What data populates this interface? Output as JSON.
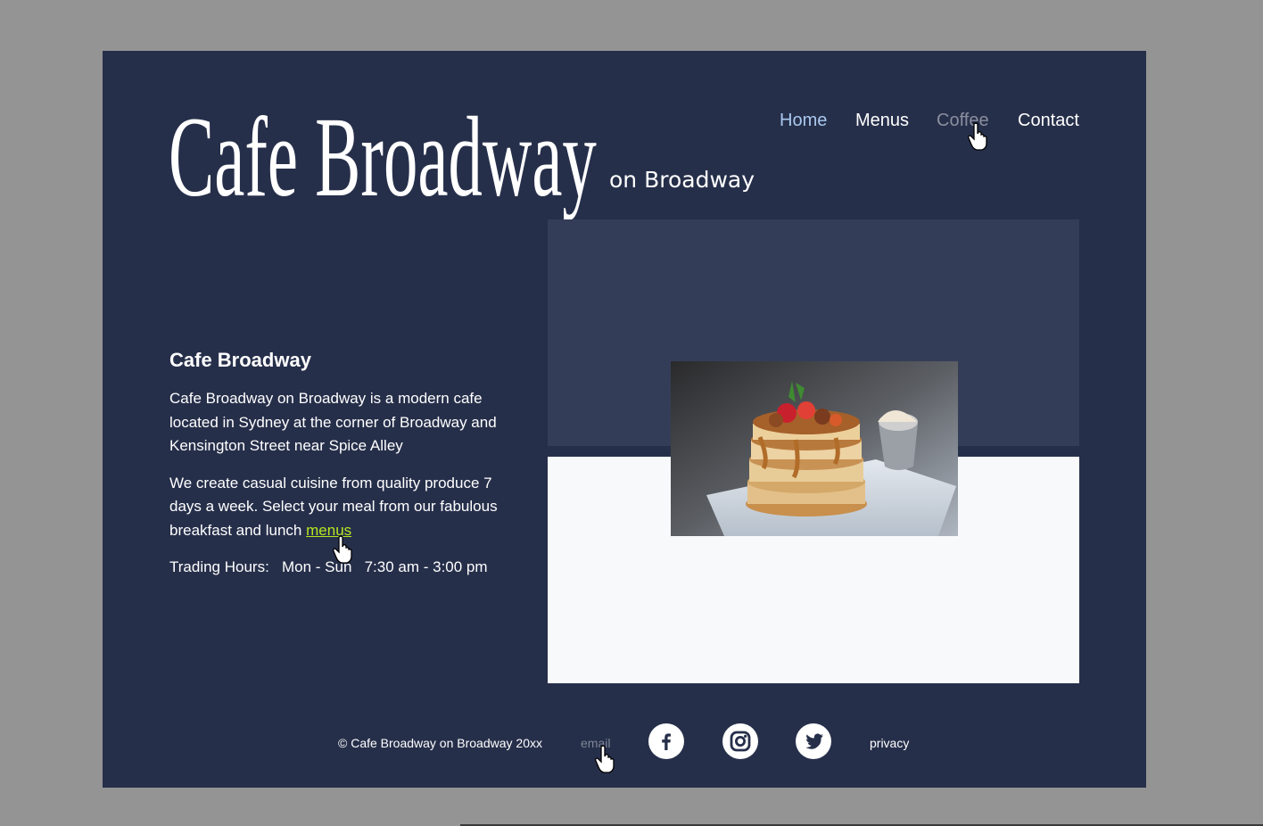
{
  "brand": {
    "name": "Cafe Broadway",
    "tagline": "on Broadway"
  },
  "nav": {
    "items": [
      "Home",
      "Menus",
      "Coffee",
      "Contact"
    ],
    "colors": {
      "home": "#a9c8ee",
      "menus": "#ffffff",
      "coffee": "#8a8f9e",
      "contact": "#ffffff"
    }
  },
  "intro": {
    "title": "Cafe Broadway",
    "para1": "Cafe Broadway on Broadway is a modern cafe located in Sydney at the corner of Broadway and Kensington Street near Spice Alley",
    "para2_text": "We create casual cuisine from quality produce 7 days a week. Select your meal from our fabulous breakfast and lunch",
    "para2_link": "menus",
    "hours_label": "Trading Hours:",
    "hours_days": "Mon - Sun",
    "hours_time": "7:30 am - 3:00 pm"
  },
  "hero": {
    "image": "pancake-stack-photo"
  },
  "footer": {
    "copyright": "© Cafe Broadway on Broadway 20xx",
    "email_label": "email",
    "social": [
      "facebook-icon",
      "instagram-icon",
      "twitter-icon"
    ],
    "privacy_label": "privacy"
  },
  "colors": {
    "page_bg": "#262f4a",
    "hero_top": "#343d58",
    "hero_bottom": "#f8f9fa",
    "link": "#b4e820",
    "outer": "#949494"
  }
}
